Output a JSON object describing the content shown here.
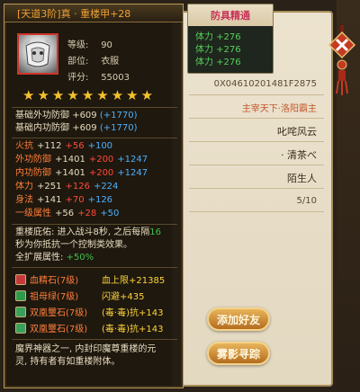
{
  "item": {
    "title": "[天道3阶]真 · 重楼甲+28",
    "level_label": "等级:",
    "level": "90",
    "slot_label": "部位:",
    "slot": "衣服",
    "score_label": "评分:",
    "score": "55003",
    "stars": 9
  },
  "base_stats": [
    {
      "name": "基础外功防御",
      "val": "+609",
      "extra": "(+1770)"
    },
    {
      "name": "基础内功防御",
      "val": "+609",
      "extra": "(+1770)"
    }
  ],
  "attrs": [
    {
      "name": "火抗",
      "a": "+112",
      "b": "+56",
      "c": "+100"
    },
    {
      "name": "外功防御",
      "a": "+1401",
      "b": "+200",
      "c": "+1247"
    },
    {
      "name": "内功防御",
      "a": "+1401",
      "b": "+200",
      "c": "+1247"
    },
    {
      "name": "体力",
      "a": "+251",
      "b": "+126",
      "c": "+224"
    },
    {
      "name": "身法",
      "a": "+141",
      "b": "+70",
      "c": "+126"
    },
    {
      "name": "一级属性",
      "a": "+56",
      "b": "+28",
      "c": "+50"
    }
  ],
  "desc1": {
    "line1_prefix": "重楼庇佑: 进入战斗8秒, 之后每隔",
    "line1_num": "16",
    "line2": "秒为你抵抗一个控制类效果。",
    "full_label": "全扩展属性: ",
    "full_val": "+50%"
  },
  "gems": [
    {
      "name": "血精石(7级)",
      "effect": "血上限+21385",
      "color": "#c43a3a"
    },
    {
      "name": "祖母绿(7级)",
      "effect": "闪避+435",
      "color": "#2f9a4a"
    },
    {
      "name": "双凰璽石(7级)",
      "effect": "(毒·毒)抗+143",
      "color": "#3aa05a"
    },
    {
      "name": "双凰璽石(7级)",
      "effect": "(毒·毒)抗+143",
      "color": "#3aa05a"
    }
  ],
  "desc2": {
    "line1": "魔界神器之一, 内封印魔尊重楼的元",
    "line2": "灵, 持有者有如重楼附体。"
  },
  "armor_tip": {
    "title": "防具精通",
    "lines": [
      "体力 +276",
      "体力 +276",
      "体力 +276"
    ]
  },
  "profile": {
    "id": "0X04610201481F2875",
    "title_text": "主宰天下·洛阳霸主",
    "name1": "叱咤风云",
    "name2": "· 清茶べ",
    "name3": "陌生人",
    "count": "5/10"
  },
  "buttons": {
    "add_friend": "添加好友",
    "track": "雾影寻踪"
  },
  "colors": {
    "gold": "#f0a033",
    "green": "#3ec24a",
    "red": "#ff4a3a",
    "blue": "#4eb0ff"
  }
}
